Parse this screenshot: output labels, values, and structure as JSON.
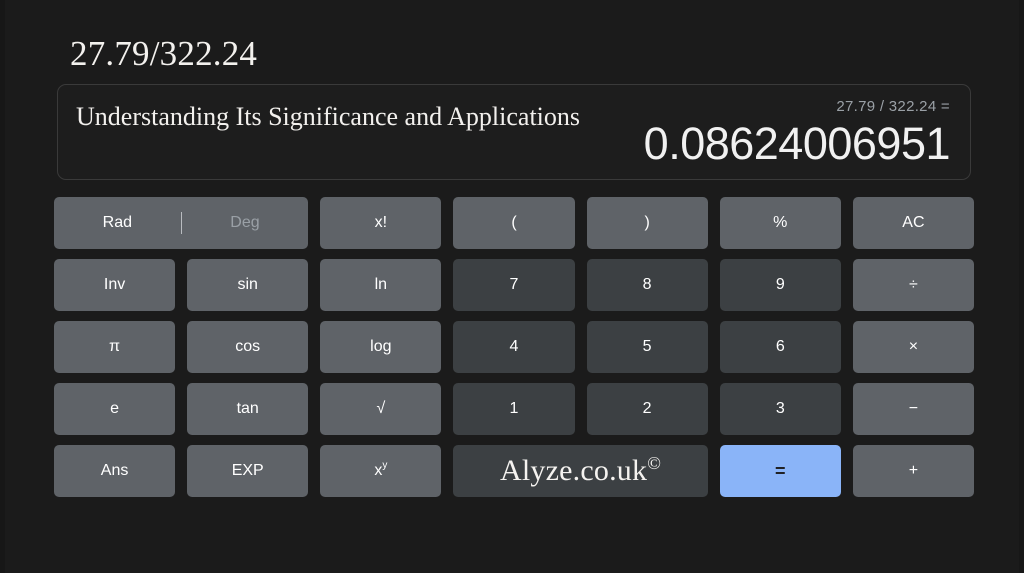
{
  "page": {
    "headline": "27.79/322.24",
    "background_color": "#1b1b1b"
  },
  "display": {
    "subtitle": "Understanding Its Significance and Applications",
    "expression": "27.79 / 322.24 =",
    "result": "0.08624006951"
  },
  "keypad": {
    "mode": {
      "active_label": "Rad",
      "inactive_label": "Deg",
      "separator": "|"
    },
    "rows": [
      [
        {
          "name": "mode-toggle",
          "type": "mode"
        },
        {
          "name": "factorial",
          "label": "x!",
          "type": "func"
        },
        {
          "name": "paren-open",
          "label": "(",
          "type": "func"
        },
        {
          "name": "paren-close",
          "label": ")",
          "type": "func"
        },
        {
          "name": "percent",
          "label": "%",
          "type": "func"
        },
        {
          "name": "all-clear",
          "label": "AC",
          "type": "func"
        }
      ],
      [
        {
          "name": "inverse",
          "label": "Inv",
          "type": "func"
        },
        {
          "name": "sine",
          "label": "sin",
          "type": "func"
        },
        {
          "name": "natural-log",
          "label": "ln",
          "type": "func"
        },
        {
          "name": "digit-7",
          "label": "7",
          "type": "digit"
        },
        {
          "name": "digit-8",
          "label": "8",
          "type": "digit"
        },
        {
          "name": "digit-9",
          "label": "9",
          "type": "digit"
        },
        {
          "name": "divide",
          "label": "÷",
          "type": "op"
        }
      ],
      [
        {
          "name": "pi",
          "label": "π",
          "type": "func"
        },
        {
          "name": "cosine",
          "label": "cos",
          "type": "func"
        },
        {
          "name": "log",
          "label": "log",
          "type": "func"
        },
        {
          "name": "digit-4",
          "label": "4",
          "type": "digit"
        },
        {
          "name": "digit-5",
          "label": "5",
          "type": "digit"
        },
        {
          "name": "digit-6",
          "label": "6",
          "type": "digit"
        },
        {
          "name": "multiply",
          "label": "×",
          "type": "op"
        }
      ],
      [
        {
          "name": "euler",
          "label": "e",
          "type": "func"
        },
        {
          "name": "tangent",
          "label": "tan",
          "type": "func"
        },
        {
          "name": "sqrt",
          "label": "√",
          "type": "func"
        },
        {
          "name": "digit-1",
          "label": "1",
          "type": "digit"
        },
        {
          "name": "digit-2",
          "label": "2",
          "type": "digit"
        },
        {
          "name": "digit-3",
          "label": "3",
          "type": "digit"
        },
        {
          "name": "subtract",
          "label": "−",
          "type": "op"
        }
      ],
      [
        {
          "name": "answer",
          "label": "Ans",
          "type": "func"
        },
        {
          "name": "exponent",
          "label": "EXP",
          "type": "func"
        },
        {
          "name": "power",
          "label": "x",
          "sup": "y",
          "type": "func"
        },
        {
          "name": "watermark-cell",
          "type": "watermark"
        },
        {
          "name": "equals",
          "label": "=",
          "type": "equals"
        },
        {
          "name": "add",
          "label": "+",
          "type": "op"
        }
      ]
    ]
  },
  "watermark": {
    "text": "Alyze.co.uk",
    "symbol": "©"
  },
  "colors": {
    "function_key": "#5f6368",
    "digit_key": "#3c4043",
    "equals_key": "#8ab4f8",
    "accent_text": "#9aa0a6"
  }
}
